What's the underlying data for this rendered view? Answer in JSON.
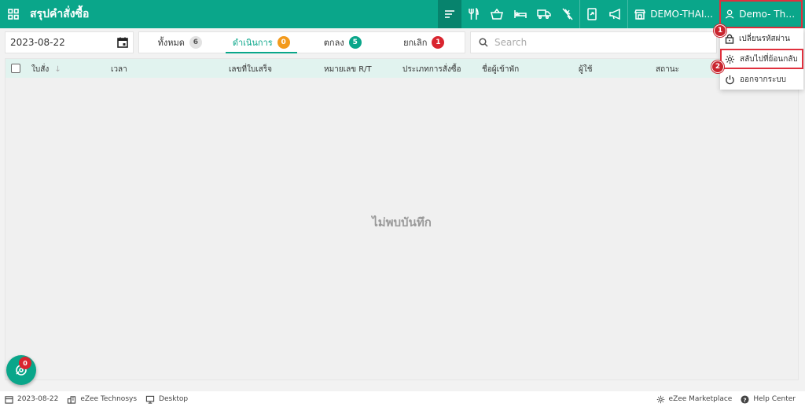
{
  "header": {
    "title": "สรุปคำสั่งซื้อ",
    "property": "DEMO-THAI...",
    "user": "Demo- Thail..."
  },
  "filters": {
    "date": "2023-08-22",
    "tabs": [
      {
        "label": "ทั้งหมด",
        "count": "6"
      },
      {
        "label": "ดำเนินการ",
        "count": "0"
      },
      {
        "label": "ตกลง",
        "count": "5"
      },
      {
        "label": "ยกเลิก",
        "count": "1"
      }
    ],
    "search_placeholder": "Search"
  },
  "table": {
    "columns": [
      "ใบสั่ง",
      "เวลา",
      "เลขที่ใบเสร็จ",
      "หมายเลข R/T",
      "ประเภทการสั่งซื้อ",
      "ชื่อผู้เข้าพัก",
      "ผู้ใช้",
      "สถานะ"
    ],
    "empty_message": "ไม่พบบันทึก"
  },
  "user_menu": {
    "items": [
      "เปลี่ยนรหัสผ่าน",
      "สลับไปที่ย้อนกลับ",
      "ออกจากระบบ"
    ],
    "steps": [
      "1",
      "2"
    ]
  },
  "fab": {
    "count": "0"
  },
  "statusbar": {
    "date": "2023-08-22",
    "company": "eZee Technosys",
    "mode": "Desktop",
    "marketplace": "eZee Marketplace",
    "help": "Help Center"
  },
  "colors": {
    "primary": "#0aa68a",
    "highlight": "#e0303d"
  }
}
